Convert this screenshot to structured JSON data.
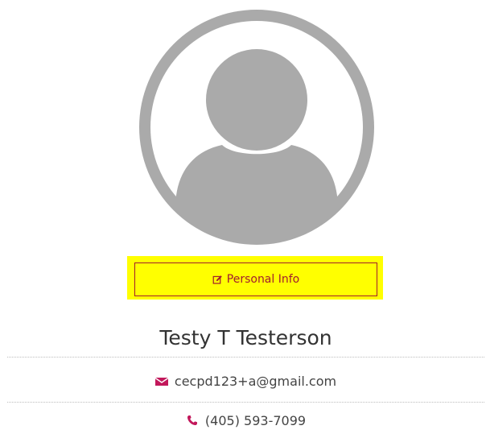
{
  "profile": {
    "avatar_icon": "default-user-avatar-icon",
    "avatar_color": "#aaaaaa",
    "personal_info_label": "Personal Info",
    "personal_info_icon": "edit-icon",
    "highlight_color": "#ffff00",
    "button_color": "#a11d2d",
    "name": "Testy T Testerson",
    "email": "cecpd123+a@gmail.com",
    "email_icon": "envelope-icon",
    "phone": "(405) 593-7099",
    "phone_icon": "phone-icon",
    "contact_icon_color": "#c2185b"
  }
}
